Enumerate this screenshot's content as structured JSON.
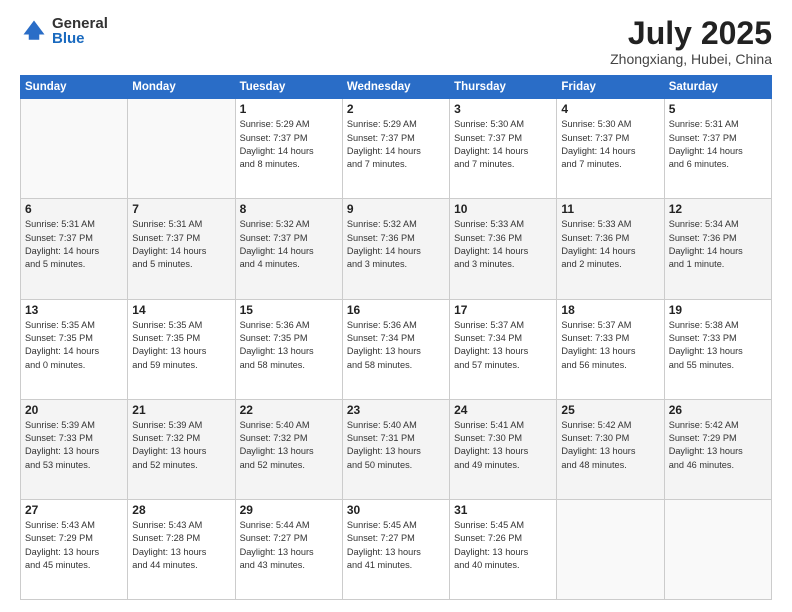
{
  "logo": {
    "general": "General",
    "blue": "Blue"
  },
  "title": {
    "month": "July 2025",
    "location": "Zhongxiang, Hubei, China"
  },
  "weekdays": [
    "Sunday",
    "Monday",
    "Tuesday",
    "Wednesday",
    "Thursday",
    "Friday",
    "Saturday"
  ],
  "weeks": [
    [
      {
        "day": "",
        "info": ""
      },
      {
        "day": "",
        "info": ""
      },
      {
        "day": "1",
        "info": "Sunrise: 5:29 AM\nSunset: 7:37 PM\nDaylight: 14 hours\nand 8 minutes."
      },
      {
        "day": "2",
        "info": "Sunrise: 5:29 AM\nSunset: 7:37 PM\nDaylight: 14 hours\nand 7 minutes."
      },
      {
        "day": "3",
        "info": "Sunrise: 5:30 AM\nSunset: 7:37 PM\nDaylight: 14 hours\nand 7 minutes."
      },
      {
        "day": "4",
        "info": "Sunrise: 5:30 AM\nSunset: 7:37 PM\nDaylight: 14 hours\nand 7 minutes."
      },
      {
        "day": "5",
        "info": "Sunrise: 5:31 AM\nSunset: 7:37 PM\nDaylight: 14 hours\nand 6 minutes."
      }
    ],
    [
      {
        "day": "6",
        "info": "Sunrise: 5:31 AM\nSunset: 7:37 PM\nDaylight: 14 hours\nand 5 minutes."
      },
      {
        "day": "7",
        "info": "Sunrise: 5:31 AM\nSunset: 7:37 PM\nDaylight: 14 hours\nand 5 minutes."
      },
      {
        "day": "8",
        "info": "Sunrise: 5:32 AM\nSunset: 7:37 PM\nDaylight: 14 hours\nand 4 minutes."
      },
      {
        "day": "9",
        "info": "Sunrise: 5:32 AM\nSunset: 7:36 PM\nDaylight: 14 hours\nand 3 minutes."
      },
      {
        "day": "10",
        "info": "Sunrise: 5:33 AM\nSunset: 7:36 PM\nDaylight: 14 hours\nand 3 minutes."
      },
      {
        "day": "11",
        "info": "Sunrise: 5:33 AM\nSunset: 7:36 PM\nDaylight: 14 hours\nand 2 minutes."
      },
      {
        "day": "12",
        "info": "Sunrise: 5:34 AM\nSunset: 7:36 PM\nDaylight: 14 hours\nand 1 minute."
      }
    ],
    [
      {
        "day": "13",
        "info": "Sunrise: 5:35 AM\nSunset: 7:35 PM\nDaylight: 14 hours\nand 0 minutes."
      },
      {
        "day": "14",
        "info": "Sunrise: 5:35 AM\nSunset: 7:35 PM\nDaylight: 13 hours\nand 59 minutes."
      },
      {
        "day": "15",
        "info": "Sunrise: 5:36 AM\nSunset: 7:35 PM\nDaylight: 13 hours\nand 58 minutes."
      },
      {
        "day": "16",
        "info": "Sunrise: 5:36 AM\nSunset: 7:34 PM\nDaylight: 13 hours\nand 58 minutes."
      },
      {
        "day": "17",
        "info": "Sunrise: 5:37 AM\nSunset: 7:34 PM\nDaylight: 13 hours\nand 57 minutes."
      },
      {
        "day": "18",
        "info": "Sunrise: 5:37 AM\nSunset: 7:33 PM\nDaylight: 13 hours\nand 56 minutes."
      },
      {
        "day": "19",
        "info": "Sunrise: 5:38 AM\nSunset: 7:33 PM\nDaylight: 13 hours\nand 55 minutes."
      }
    ],
    [
      {
        "day": "20",
        "info": "Sunrise: 5:39 AM\nSunset: 7:33 PM\nDaylight: 13 hours\nand 53 minutes."
      },
      {
        "day": "21",
        "info": "Sunrise: 5:39 AM\nSunset: 7:32 PM\nDaylight: 13 hours\nand 52 minutes."
      },
      {
        "day": "22",
        "info": "Sunrise: 5:40 AM\nSunset: 7:32 PM\nDaylight: 13 hours\nand 52 minutes."
      },
      {
        "day": "23",
        "info": "Sunrise: 5:40 AM\nSunset: 7:31 PM\nDaylight: 13 hours\nand 50 minutes."
      },
      {
        "day": "24",
        "info": "Sunrise: 5:41 AM\nSunset: 7:30 PM\nDaylight: 13 hours\nand 49 minutes."
      },
      {
        "day": "25",
        "info": "Sunrise: 5:42 AM\nSunset: 7:30 PM\nDaylight: 13 hours\nand 48 minutes."
      },
      {
        "day": "26",
        "info": "Sunrise: 5:42 AM\nSunset: 7:29 PM\nDaylight: 13 hours\nand 46 minutes."
      }
    ],
    [
      {
        "day": "27",
        "info": "Sunrise: 5:43 AM\nSunset: 7:29 PM\nDaylight: 13 hours\nand 45 minutes."
      },
      {
        "day": "28",
        "info": "Sunrise: 5:43 AM\nSunset: 7:28 PM\nDaylight: 13 hours\nand 44 minutes."
      },
      {
        "day": "29",
        "info": "Sunrise: 5:44 AM\nSunset: 7:27 PM\nDaylight: 13 hours\nand 43 minutes."
      },
      {
        "day": "30",
        "info": "Sunrise: 5:45 AM\nSunset: 7:27 PM\nDaylight: 13 hours\nand 41 minutes."
      },
      {
        "day": "31",
        "info": "Sunrise: 5:45 AM\nSunset: 7:26 PM\nDaylight: 13 hours\nand 40 minutes."
      },
      {
        "day": "",
        "info": ""
      },
      {
        "day": "",
        "info": ""
      }
    ]
  ]
}
